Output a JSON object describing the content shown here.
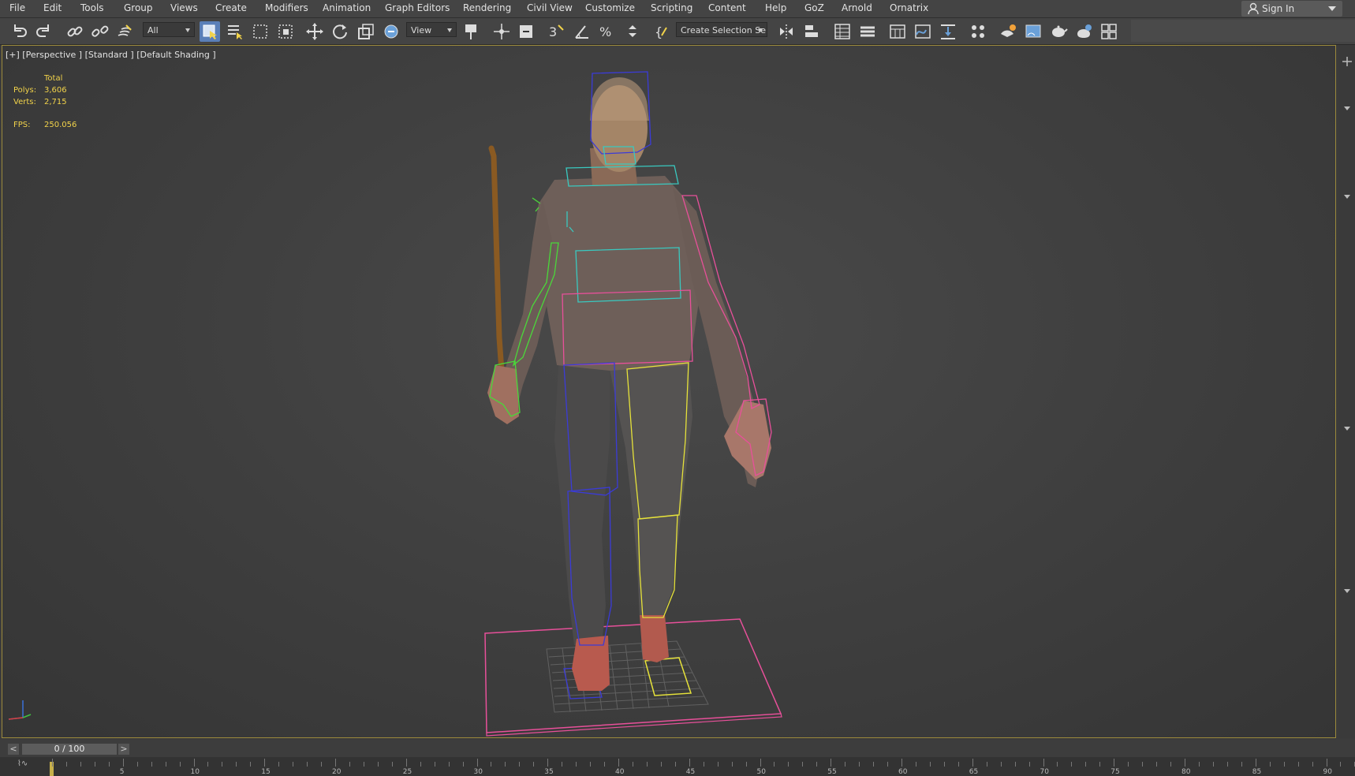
{
  "menu": [
    "File",
    "Edit",
    "Tools",
    "Group",
    "Views",
    "Create",
    "Modifiers",
    "Animation",
    "Graph Editors",
    "Rendering",
    "Civil View",
    "Customize",
    "Scripting",
    "Content",
    "Help",
    "GoZ",
    "Arnold",
    "Ornatrix"
  ],
  "signin": {
    "label": "Sign In"
  },
  "toolbar": {
    "filter_label": "All",
    "refcoord_label": "View",
    "selection_set_label": "Create Selection Se"
  },
  "viewport": {
    "label": "[+] [Perspective ] [Standard ] [Default Shading ]",
    "stats": {
      "header": "Total",
      "polys_label": "Polys:",
      "polys_value": "3,606",
      "verts_label": "Verts:",
      "verts_value": "2,715",
      "fps_label": "FPS:",
      "fps_value": "250.056"
    }
  },
  "timeline": {
    "slider_label": "0 / 100",
    "prev_label": "<",
    "next_label": ">",
    "ruler_numbers": [
      "5",
      "10",
      "15",
      "20",
      "25",
      "30",
      "35",
      "40",
      "45",
      "50",
      "55",
      "60",
      "65",
      "70",
      "75",
      "80",
      "85",
      "90"
    ]
  },
  "colors": {
    "accent": "#f2d34a",
    "viewport_border": "#9c8a3c",
    "selection": "#e8509a"
  }
}
